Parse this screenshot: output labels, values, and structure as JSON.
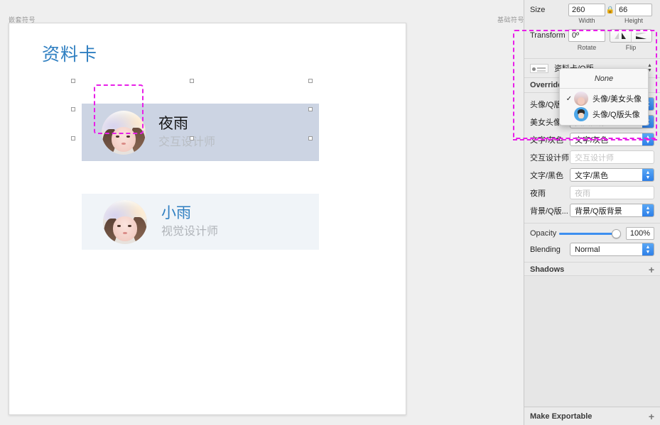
{
  "canvas": {
    "left_page_label": "嵌套符号",
    "right_page_label": "基础符号",
    "artboard_title": "资料卡",
    "cards": [
      {
        "name": "夜雨",
        "role": "交互设计师",
        "selected": true
      },
      {
        "name": "小雨",
        "role": "视觉设计师",
        "selected": false
      }
    ]
  },
  "inspector": {
    "size": {
      "label": "Size",
      "width_value": "260",
      "height_value": "66",
      "width_caption": "Width",
      "height_caption": "Height",
      "lock_icon": "lock-icon"
    },
    "transform": {
      "label": "Transform",
      "rotate_value": "0º",
      "rotate_caption": "Rotate",
      "flip_caption": "Flip"
    },
    "symbol": {
      "name": "资料卡/Q版",
      "thumbnail_icon": "symbol-thumbnail-icon"
    },
    "overrides": {
      "header": "Overrides",
      "rows": [
        {
          "label": "头像/Q版...",
          "value": "头像/Q版头像",
          "type": "select"
        },
        {
          "label": "美女头像",
          "value": "美女头像",
          "type": "select"
        },
        {
          "label": "文字/灰色",
          "value": "文字/灰色",
          "type": "select"
        },
        {
          "label": "交互设计师",
          "value": "交互设计师",
          "type": "text"
        },
        {
          "label": "文字/黑色",
          "value": "文字/黑色",
          "type": "select"
        },
        {
          "label": "夜雨",
          "value": "夜雨",
          "type": "text"
        },
        {
          "label": "背景/Q版...",
          "value": "背景/Q版背景",
          "type": "select"
        }
      ]
    },
    "opacity": {
      "label": "Opacity",
      "value": "100%"
    },
    "blending": {
      "label": "Blending",
      "value": "Normal"
    },
    "shadows": {
      "label": "Shadows",
      "add_icon": "plus-icon"
    },
    "make_exportable": {
      "label": "Make Exportable",
      "add_icon": "plus-icon"
    }
  },
  "dropdown": {
    "none_label": "None",
    "items": [
      {
        "label": "头像/美女头像",
        "checked": true,
        "thumb": "girl-avatar-icon"
      },
      {
        "label": "头像/Q版头像",
        "checked": false,
        "thumb": "q-avatar-icon"
      }
    ]
  },
  "colors": {
    "accent_blue": "#2f7fc1",
    "selection_magenta": "#e81fe8",
    "selected_card_bg": "#ccd4e3",
    "plain_card_bg": "#f0f4f8",
    "panel_bg": "#ebebeb"
  }
}
